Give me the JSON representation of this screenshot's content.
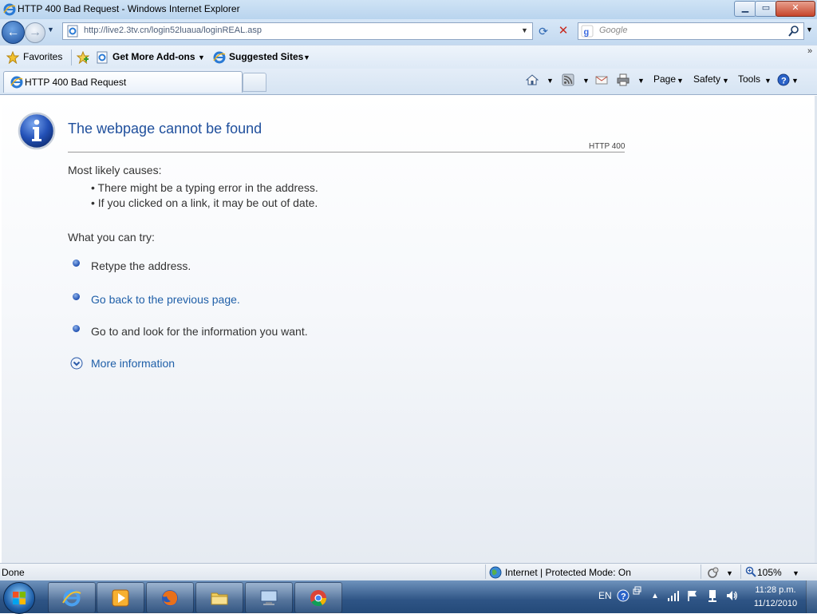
{
  "window": {
    "title": "HTTP 400 Bad Request - Windows Internet Explorer",
    "min_label": "▁",
    "max_label": "▭",
    "close_label": "✕"
  },
  "address_bar": {
    "url": "http://live2.3tv.cn/login52luaua/loginREAL.asp",
    "icon": "ie-page-icon"
  },
  "search": {
    "placeholder": "Google",
    "icon": "magnifier-icon"
  },
  "favorites_bar": {
    "favorites_label": "Favorites",
    "addons_label": "Get More Add-ons",
    "suggested_label": "Suggested Sites"
  },
  "tab": {
    "label": "HTTP 400 Bad Request"
  },
  "command_bar": {
    "page_label": "Page",
    "safety_label": "Safety",
    "tools_label": "Tools"
  },
  "error_page": {
    "title": "The webpage cannot be found",
    "code": "HTTP 400",
    "causes_title": "Most likely causes:",
    "causes": [
      "There might be a typing error in the address.",
      "If you clicked on a link, it may be out of date."
    ],
    "try_title": "What you can try:",
    "try_items": [
      "Retype the address.",
      "Go back to the previous page.",
      "Go to  and look for the information you want."
    ],
    "more_info": "More information",
    "bullet_color": "#1f4fb0",
    "title_color": "#1f4f9c",
    "link_color": "#1f5fa8"
  },
  "status_bar": {
    "status": "Done",
    "zone": "Internet | Protected Mode: On",
    "zoom": "105%"
  },
  "taskbar": {
    "apps": [
      "internet-explorer",
      "media-player",
      "firefox",
      "windows-explorer",
      "remote-desktop",
      "chrome"
    ],
    "language": "EN",
    "time": "11:28 p.m.",
    "date": "11/12/2010"
  }
}
